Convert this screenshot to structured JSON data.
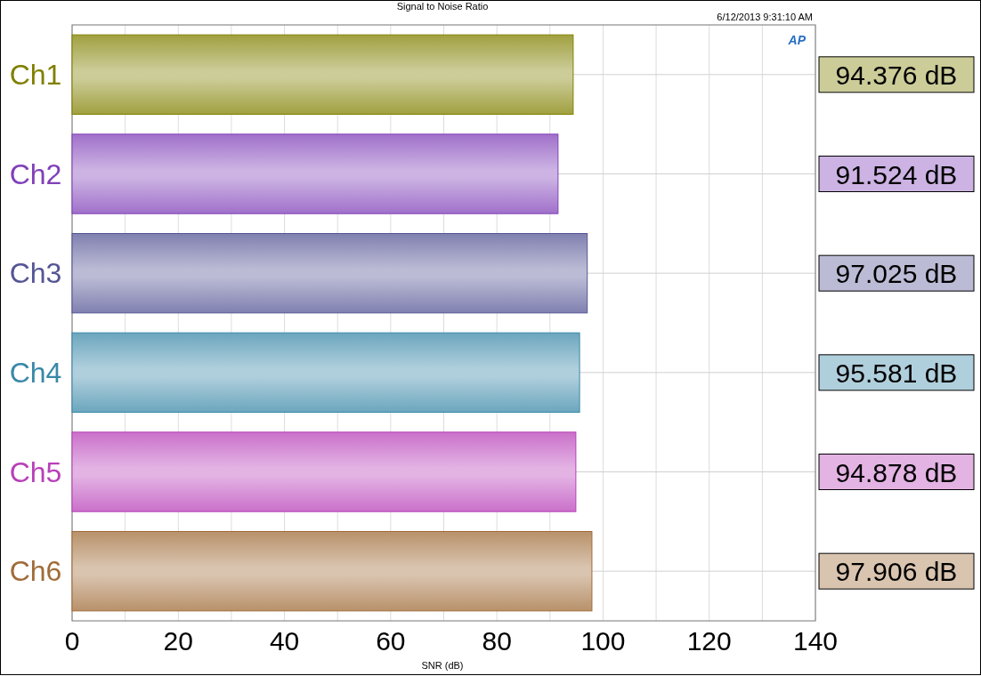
{
  "title": "Signal to Noise Ratio",
  "timestamp": "6/12/2013 9:31:10 AM",
  "logo": "AP",
  "channels": [
    {
      "color": "#808000",
      "reading": "94.376 dB"
    },
    {
      "color": "#8040b8",
      "reading": "91.524 dB"
    },
    {
      "color": "#555595",
      "reading": "97.025 dB"
    },
    {
      "color": "#3a88a8",
      "reading": "95.581 dB"
    },
    {
      "color": "#b840b8",
      "reading": "94.878 dB"
    },
    {
      "color": "#a06c38",
      "reading": "97.906 dB"
    }
  ],
  "chart_data": {
    "type": "bar",
    "orientation": "horizontal",
    "xlabel": "SNR (dB)",
    "categories": [
      "Ch1",
      "Ch2",
      "Ch3",
      "Ch4",
      "Ch5",
      "Ch6"
    ],
    "grid": true,
    "series": [
      {
        "values": [
          94.376,
          91.524,
          97.025,
          95.581,
          94.878,
          97.906
        ]
      }
    ],
    "xlim": [
      0,
      140
    ],
    "xticks": [
      0,
      20,
      40,
      60,
      80,
      100,
      120,
      140
    ]
  }
}
